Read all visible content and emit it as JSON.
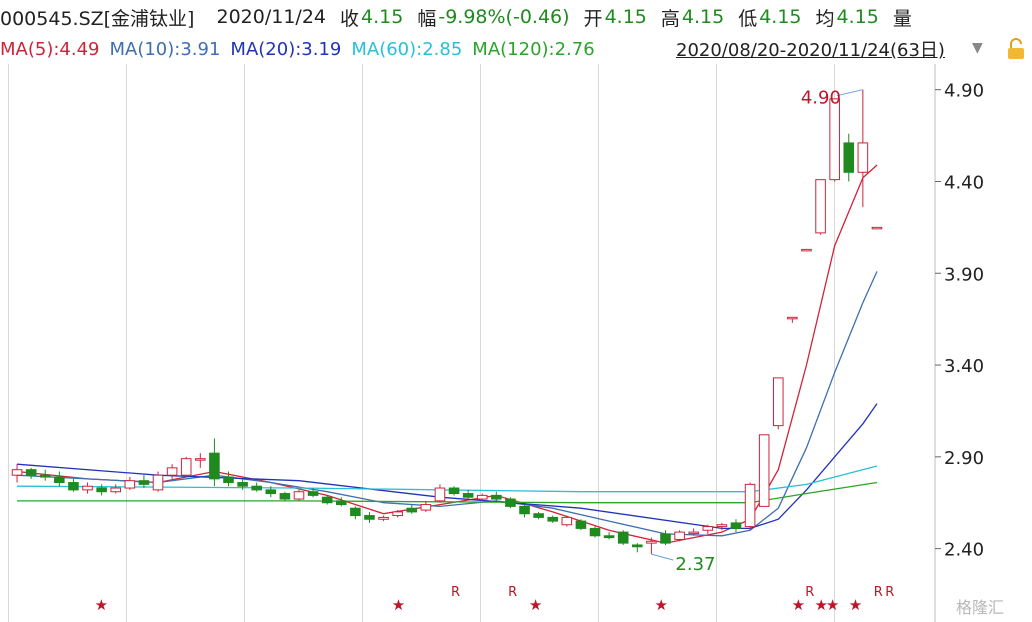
{
  "header": {
    "code": "000545.SZ[金浦钛业]",
    "date": "2020/11/24",
    "close_label": "收",
    "close": "4.15",
    "change_label": "幅",
    "change": "-9.98%(-0.46)",
    "open_label": "开",
    "open": "4.15",
    "high_label": "高",
    "high": "4.15",
    "low_label": "低",
    "low": "4.15",
    "avg_label": "均",
    "avg": "4.15",
    "vol_label": "量"
  },
  "ma_legend": [
    {
      "label": "MA(5):4.49",
      "color": "#d0233a"
    },
    {
      "label": "MA(10):3.91",
      "color": "#3f6fb0"
    },
    {
      "label": "MA(20):3.19",
      "color": "#2233bb"
    },
    {
      "label": "MA(60):2.85",
      "color": "#27c0d8"
    },
    {
      "label": "MA(120):2.76",
      "color": "#2aa52a"
    }
  ],
  "range_label": "2020/08/20-2020/11/24(63日)",
  "watermark": "格隆汇",
  "colors": {
    "up": "#d0233a",
    "down": "#1f8a1f",
    "grid": "#d8d8d8",
    "axis_text": "#222222"
  },
  "chart_data": {
    "type": "candlestick",
    "x_range": [
      "2020/08/20",
      "2020/11/24"
    ],
    "y_ticks": [
      "4.90",
      "4.40",
      "3.90",
      "3.40",
      "2.90",
      "2.40"
    ],
    "ylim": [
      2.18,
      5.04
    ],
    "annotations": {
      "high_label": "4.90",
      "low_label": "2.37"
    },
    "candles": [
      [
        2.8,
        2.86,
        2.76,
        2.83
      ],
      [
        2.83,
        2.84,
        2.78,
        2.8
      ],
      [
        2.8,
        2.83,
        2.77,
        2.79
      ],
      [
        2.79,
        2.82,
        2.74,
        2.76
      ],
      [
        2.76,
        2.78,
        2.71,
        2.72
      ],
      [
        2.72,
        2.76,
        2.7,
        2.74
      ],
      [
        2.73,
        2.75,
        2.69,
        2.71
      ],
      [
        2.71,
        2.75,
        2.7,
        2.73
      ],
      [
        2.73,
        2.79,
        2.72,
        2.77
      ],
      [
        2.77,
        2.8,
        2.73,
        2.75
      ],
      [
        2.72,
        2.82,
        2.71,
        2.8
      ],
      [
        2.8,
        2.86,
        2.78,
        2.84
      ],
      [
        2.8,
        2.9,
        2.79,
        2.89
      ],
      [
        2.89,
        2.92,
        2.84,
        2.89
      ],
      [
        2.92,
        3.0,
        2.74,
        2.78
      ],
      [
        2.79,
        2.82,
        2.74,
        2.76
      ],
      [
        2.76,
        2.78,
        2.72,
        2.74
      ],
      [
        2.74,
        2.76,
        2.71,
        2.72
      ],
      [
        2.72,
        2.74,
        2.68,
        2.7
      ],
      [
        2.7,
        2.71,
        2.66,
        2.67
      ],
      [
        2.67,
        2.72,
        2.66,
        2.71
      ],
      [
        2.71,
        2.73,
        2.68,
        2.69
      ],
      [
        2.68,
        2.69,
        2.64,
        2.65
      ],
      [
        2.66,
        2.68,
        2.63,
        2.64
      ],
      [
        2.62,
        2.63,
        2.56,
        2.58
      ],
      [
        2.58,
        2.6,
        2.54,
        2.56
      ],
      [
        2.56,
        2.58,
        2.55,
        2.57
      ],
      [
        2.58,
        2.61,
        2.57,
        2.6
      ],
      [
        2.62,
        2.64,
        2.59,
        2.6
      ],
      [
        2.61,
        2.66,
        2.6,
        2.64
      ],
      [
        2.66,
        2.75,
        2.65,
        2.73
      ],
      [
        2.73,
        2.74,
        2.69,
        2.7
      ],
      [
        2.7,
        2.72,
        2.67,
        2.68
      ],
      [
        2.67,
        2.7,
        2.66,
        2.69
      ],
      [
        2.69,
        2.71,
        2.66,
        2.67
      ],
      [
        2.67,
        2.68,
        2.62,
        2.63
      ],
      [
        2.63,
        2.64,
        2.57,
        2.59
      ],
      [
        2.59,
        2.6,
        2.56,
        2.57
      ],
      [
        2.57,
        2.58,
        2.54,
        2.55
      ],
      [
        2.53,
        2.58,
        2.52,
        2.57
      ],
      [
        2.55,
        2.56,
        2.5,
        2.51
      ],
      [
        2.51,
        2.52,
        2.46,
        2.47
      ],
      [
        2.47,
        2.49,
        2.45,
        2.46
      ],
      [
        2.49,
        2.5,
        2.42,
        2.43
      ],
      [
        2.42,
        2.43,
        2.38,
        2.41
      ],
      [
        2.43,
        2.46,
        2.37,
        2.44
      ],
      [
        2.48,
        2.5,
        2.42,
        2.43
      ],
      [
        2.45,
        2.5,
        2.44,
        2.49
      ],
      [
        2.49,
        2.51,
        2.47,
        2.49
      ],
      [
        2.5,
        2.53,
        2.48,
        2.52
      ],
      [
        2.52,
        2.54,
        2.5,
        2.53
      ],
      [
        2.54,
        2.56,
        2.49,
        2.51
      ],
      [
        2.52,
        2.76,
        2.5,
        2.75
      ],
      [
        2.63,
        3.02,
        2.63,
        3.02
      ],
      [
        3.07,
        3.33,
        3.05,
        3.33
      ],
      [
        3.66,
        3.66,
        3.63,
        3.66
      ],
      [
        4.03,
        4.03,
        4.03,
        4.03
      ],
      [
        4.12,
        4.41,
        4.11,
        4.41
      ],
      [
        4.41,
        4.85,
        4.4,
        4.85
      ],
      [
        4.61,
        4.66,
        4.4,
        4.45
      ],
      [
        4.45,
        4.9,
        4.26,
        4.61
      ],
      [
        4.15,
        4.15,
        4.15,
        4.15
      ]
    ],
    "ma": {
      "MA5": [
        [
          0,
          2.82
        ],
        [
          5,
          2.78
        ],
        [
          10,
          2.76
        ],
        [
          14,
          2.82
        ],
        [
          18,
          2.76
        ],
        [
          22,
          2.69
        ],
        [
          26,
          2.59
        ],
        [
          30,
          2.64
        ],
        [
          34,
          2.69
        ],
        [
          38,
          2.6
        ],
        [
          42,
          2.5
        ],
        [
          46,
          2.43
        ],
        [
          50,
          2.49
        ],
        [
          52,
          2.56
        ],
        [
          54,
          2.83
        ],
        [
          56,
          3.4
        ],
        [
          58,
          4.05
        ],
        [
          60,
          4.42
        ],
        [
          61,
          4.49
        ]
      ],
      "MA10": [
        [
          0,
          2.8
        ],
        [
          5,
          2.78
        ],
        [
          10,
          2.76
        ],
        [
          14,
          2.8
        ],
        [
          18,
          2.76
        ],
        [
          22,
          2.71
        ],
        [
          26,
          2.65
        ],
        [
          30,
          2.63
        ],
        [
          34,
          2.66
        ],
        [
          38,
          2.62
        ],
        [
          42,
          2.55
        ],
        [
          46,
          2.48
        ],
        [
          50,
          2.47
        ],
        [
          52,
          2.5
        ],
        [
          54,
          2.62
        ],
        [
          56,
          2.95
        ],
        [
          58,
          3.36
        ],
        [
          60,
          3.74
        ],
        [
          61,
          3.91
        ]
      ],
      "MA20": [
        [
          0,
          2.86
        ],
        [
          10,
          2.8
        ],
        [
          20,
          2.77
        ],
        [
          30,
          2.68
        ],
        [
          40,
          2.62
        ],
        [
          50,
          2.51
        ],
        [
          52,
          2.51
        ],
        [
          54,
          2.56
        ],
        [
          56,
          2.72
        ],
        [
          58,
          2.9
        ],
        [
          60,
          3.08
        ],
        [
          61,
          3.19
        ]
      ],
      "MA60": [
        [
          0,
          2.74
        ],
        [
          20,
          2.73
        ],
        [
          40,
          2.71
        ],
        [
          52,
          2.71
        ],
        [
          56,
          2.75
        ],
        [
          58,
          2.79
        ],
        [
          61,
          2.85
        ]
      ],
      "MA120": [
        [
          0,
          2.66
        ],
        [
          20,
          2.66
        ],
        [
          40,
          2.65
        ],
        [
          52,
          2.65
        ],
        [
          56,
          2.7
        ],
        [
          61,
          2.76
        ]
      ]
    },
    "markers": [
      {
        "i": 8,
        "t": "★"
      },
      {
        "i": 34,
        "t": "★"
      },
      {
        "i": 39,
        "t": "R"
      },
      {
        "i": 44,
        "t": "R"
      },
      {
        "i": 46,
        "t": "★"
      },
      {
        "i": 57,
        "t": "★"
      },
      {
        "i": 69,
        "t": "★"
      },
      {
        "i": 70,
        "t": "R"
      },
      {
        "i": 71,
        "t": "★"
      },
      {
        "i": 72,
        "t": "★"
      },
      {
        "i": 74,
        "t": "★"
      },
      {
        "i": 76,
        "t": "R"
      },
      {
        "i": 77,
        "t": "R"
      }
    ]
  }
}
